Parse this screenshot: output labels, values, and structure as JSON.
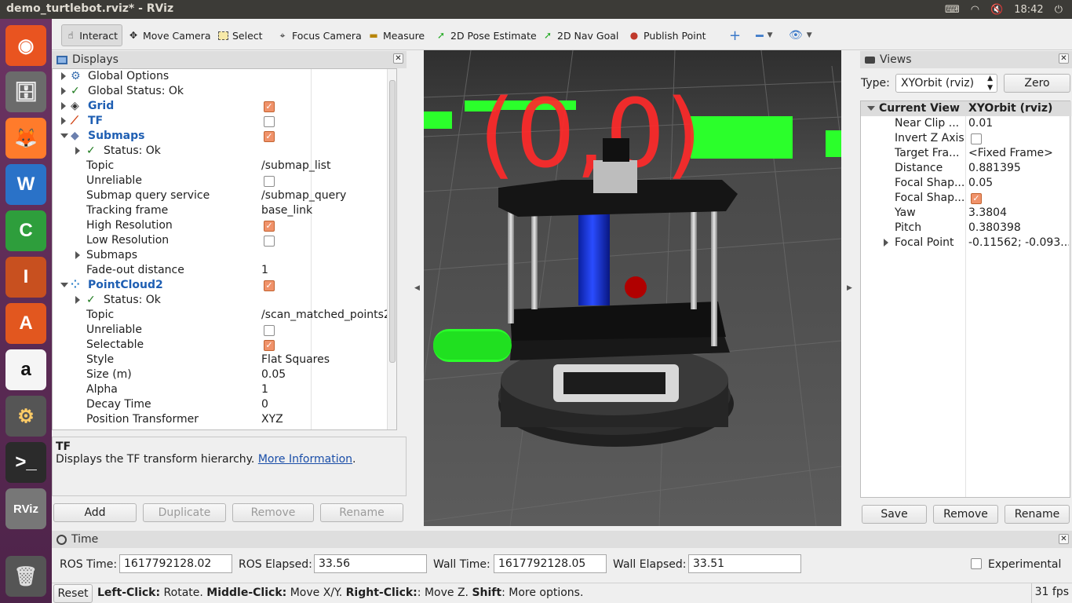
{
  "window": {
    "title": "demo_turtlebot.rviz* - RViz",
    "clock": "18:42"
  },
  "tray": {
    "keyboard_icon": "keyboard-icon",
    "wifi_icon": "wifi-icon",
    "volume_icon": "volume-muted-icon",
    "power_icon": "power-icon"
  },
  "launcher": {
    "items": [
      {
        "name": "ubuntu-dash-icon",
        "glyph": "◉"
      },
      {
        "name": "files-icon",
        "glyph": "🗄"
      },
      {
        "name": "firefox-icon",
        "glyph": "🦊"
      },
      {
        "name": "writer-icon",
        "glyph": "W"
      },
      {
        "name": "calc-icon",
        "glyph": "C"
      },
      {
        "name": "impress-icon",
        "glyph": "I"
      },
      {
        "name": "software-center-icon",
        "glyph": "A"
      },
      {
        "name": "amazon-icon",
        "glyph": "a"
      },
      {
        "name": "settings-icon",
        "glyph": "⚙"
      },
      {
        "name": "terminal-icon",
        "glyph": ">_"
      },
      {
        "name": "rviz-icon",
        "glyph": "RViz"
      },
      {
        "name": "trash-icon",
        "glyph": "🗑"
      }
    ]
  },
  "toolbar": {
    "interact": "Interact",
    "move_camera": "Move Camera",
    "select": "Select",
    "focus_camera": "Focus Camera",
    "measure": "Measure",
    "pose_estimate": "2D Pose Estimate",
    "nav_goal": "2D Nav Goal",
    "publish_point": "Publish Point"
  },
  "displays": {
    "title": "Displays",
    "rows": [
      {
        "indent": 0,
        "arrow": "closed",
        "icon": "gear",
        "name": "Global Options",
        "bold": false,
        "value": ""
      },
      {
        "indent": 0,
        "arrow": "closed",
        "icon": "check",
        "name": "Global Status: Ok",
        "bold": false,
        "value": ""
      },
      {
        "indent": 0,
        "arrow": "closed",
        "icon": "grid",
        "name": "Grid",
        "bold": true,
        "value": "",
        "check": true
      },
      {
        "indent": 0,
        "arrow": "closed",
        "icon": "tf",
        "name": "TF",
        "bold": true,
        "value": "",
        "check": false
      },
      {
        "indent": 0,
        "arrow": "open",
        "icon": "submap",
        "name": "Submaps",
        "bold": true,
        "value": "",
        "check": true
      },
      {
        "indent": 1,
        "arrow": "closed",
        "icon": "check",
        "name": "Status: Ok",
        "bold": false,
        "value": ""
      },
      {
        "indent": 1,
        "arrow": "none",
        "icon": "",
        "name": "Topic",
        "bold": false,
        "value": "/submap_list"
      },
      {
        "indent": 1,
        "arrow": "none",
        "icon": "",
        "name": "Unreliable",
        "bold": false,
        "value": "",
        "check": false
      },
      {
        "indent": 1,
        "arrow": "none",
        "icon": "",
        "name": "Submap query service",
        "bold": false,
        "value": "/submap_query"
      },
      {
        "indent": 1,
        "arrow": "none",
        "icon": "",
        "name": "Tracking frame",
        "bold": false,
        "value": "base_link"
      },
      {
        "indent": 1,
        "arrow": "none",
        "icon": "",
        "name": "High Resolution",
        "bold": false,
        "value": "",
        "check": true
      },
      {
        "indent": 1,
        "arrow": "none",
        "icon": "",
        "name": "Low Resolution",
        "bold": false,
        "value": "",
        "check": false
      },
      {
        "indent": 1,
        "arrow": "closed",
        "icon": "",
        "name": "Submaps",
        "bold": false,
        "value": ""
      },
      {
        "indent": 1,
        "arrow": "none",
        "icon": "",
        "name": "Fade-out distance",
        "bold": false,
        "value": "1"
      },
      {
        "indent": 0,
        "arrow": "open",
        "icon": "cloud",
        "name": "PointCloud2",
        "bold": true,
        "value": "",
        "check": true
      },
      {
        "indent": 1,
        "arrow": "closed",
        "icon": "check",
        "name": "Status: Ok",
        "bold": false,
        "value": ""
      },
      {
        "indent": 1,
        "arrow": "none",
        "icon": "",
        "name": "Topic",
        "bold": false,
        "value": "/scan_matched_points2"
      },
      {
        "indent": 1,
        "arrow": "none",
        "icon": "",
        "name": "Unreliable",
        "bold": false,
        "value": "",
        "check": false
      },
      {
        "indent": 1,
        "arrow": "none",
        "icon": "",
        "name": "Selectable",
        "bold": false,
        "value": "",
        "check": true
      },
      {
        "indent": 1,
        "arrow": "none",
        "icon": "",
        "name": "Style",
        "bold": false,
        "value": "Flat Squares"
      },
      {
        "indent": 1,
        "arrow": "none",
        "icon": "",
        "name": "Size (m)",
        "bold": false,
        "value": "0.05"
      },
      {
        "indent": 1,
        "arrow": "none",
        "icon": "",
        "name": "Alpha",
        "bold": false,
        "value": "1"
      },
      {
        "indent": 1,
        "arrow": "none",
        "icon": "",
        "name": "Decay Time",
        "bold": false,
        "value": "0"
      },
      {
        "indent": 1,
        "arrow": "none",
        "icon": "",
        "name": "Position Transformer",
        "bold": false,
        "value": "XYZ"
      }
    ],
    "desc_title": "TF",
    "desc_text": "Displays the TF transform hierarchy.",
    "desc_link": "More Information",
    "desc_end": ".",
    "buttons": {
      "add": "Add",
      "duplicate": "Duplicate",
      "remove": "Remove",
      "rename": "Rename"
    }
  },
  "scene": {
    "overlay_text": "(0,0)"
  },
  "views": {
    "title": "Views",
    "type_label": "Type:",
    "type_value": "XYOrbit (rviz)",
    "zero": "Zero",
    "header": {
      "name": "Current View",
      "value": "XYOrbit (rviz)"
    },
    "rows": [
      {
        "name": "Near Clip ...",
        "value": "0.01"
      },
      {
        "name": "Invert Z Axis",
        "value": "",
        "check": false
      },
      {
        "name": "Target Fra...",
        "value": "<Fixed Frame>"
      },
      {
        "name": "Distance",
        "value": "0.881395"
      },
      {
        "name": "Focal Shap...",
        "value": "0.05"
      },
      {
        "name": "Focal Shap...",
        "value": "",
        "check": true
      },
      {
        "name": "Yaw",
        "value": "3.3804"
      },
      {
        "name": "Pitch",
        "value": "0.380398"
      },
      {
        "name": "Focal Point",
        "value": "-0.11562; -0.093...",
        "arrow": true
      }
    ],
    "buttons": {
      "save": "Save",
      "remove": "Remove",
      "rename": "Rename"
    }
  },
  "time": {
    "title": "Time",
    "ros_time_label": "ROS Time:",
    "ros_time": "1617792128.02",
    "ros_elapsed_label": "ROS Elapsed:",
    "ros_elapsed": "33.56",
    "wall_time_label": "Wall Time:",
    "wall_time": "1617792128.05",
    "wall_elapsed_label": "Wall Elapsed:",
    "wall_elapsed": "33.51",
    "experimental": "Experimental"
  },
  "status": {
    "reset": "Reset",
    "b1": "Left-Click:",
    "t1": " Rotate. ",
    "b2": "Middle-Click:",
    "t2": " Move X/Y. ",
    "b3": "Right-Click:",
    "t3": ": Move Z. ",
    "b4": "Shift",
    "t4": ": More options.",
    "fps": "31 fps"
  }
}
